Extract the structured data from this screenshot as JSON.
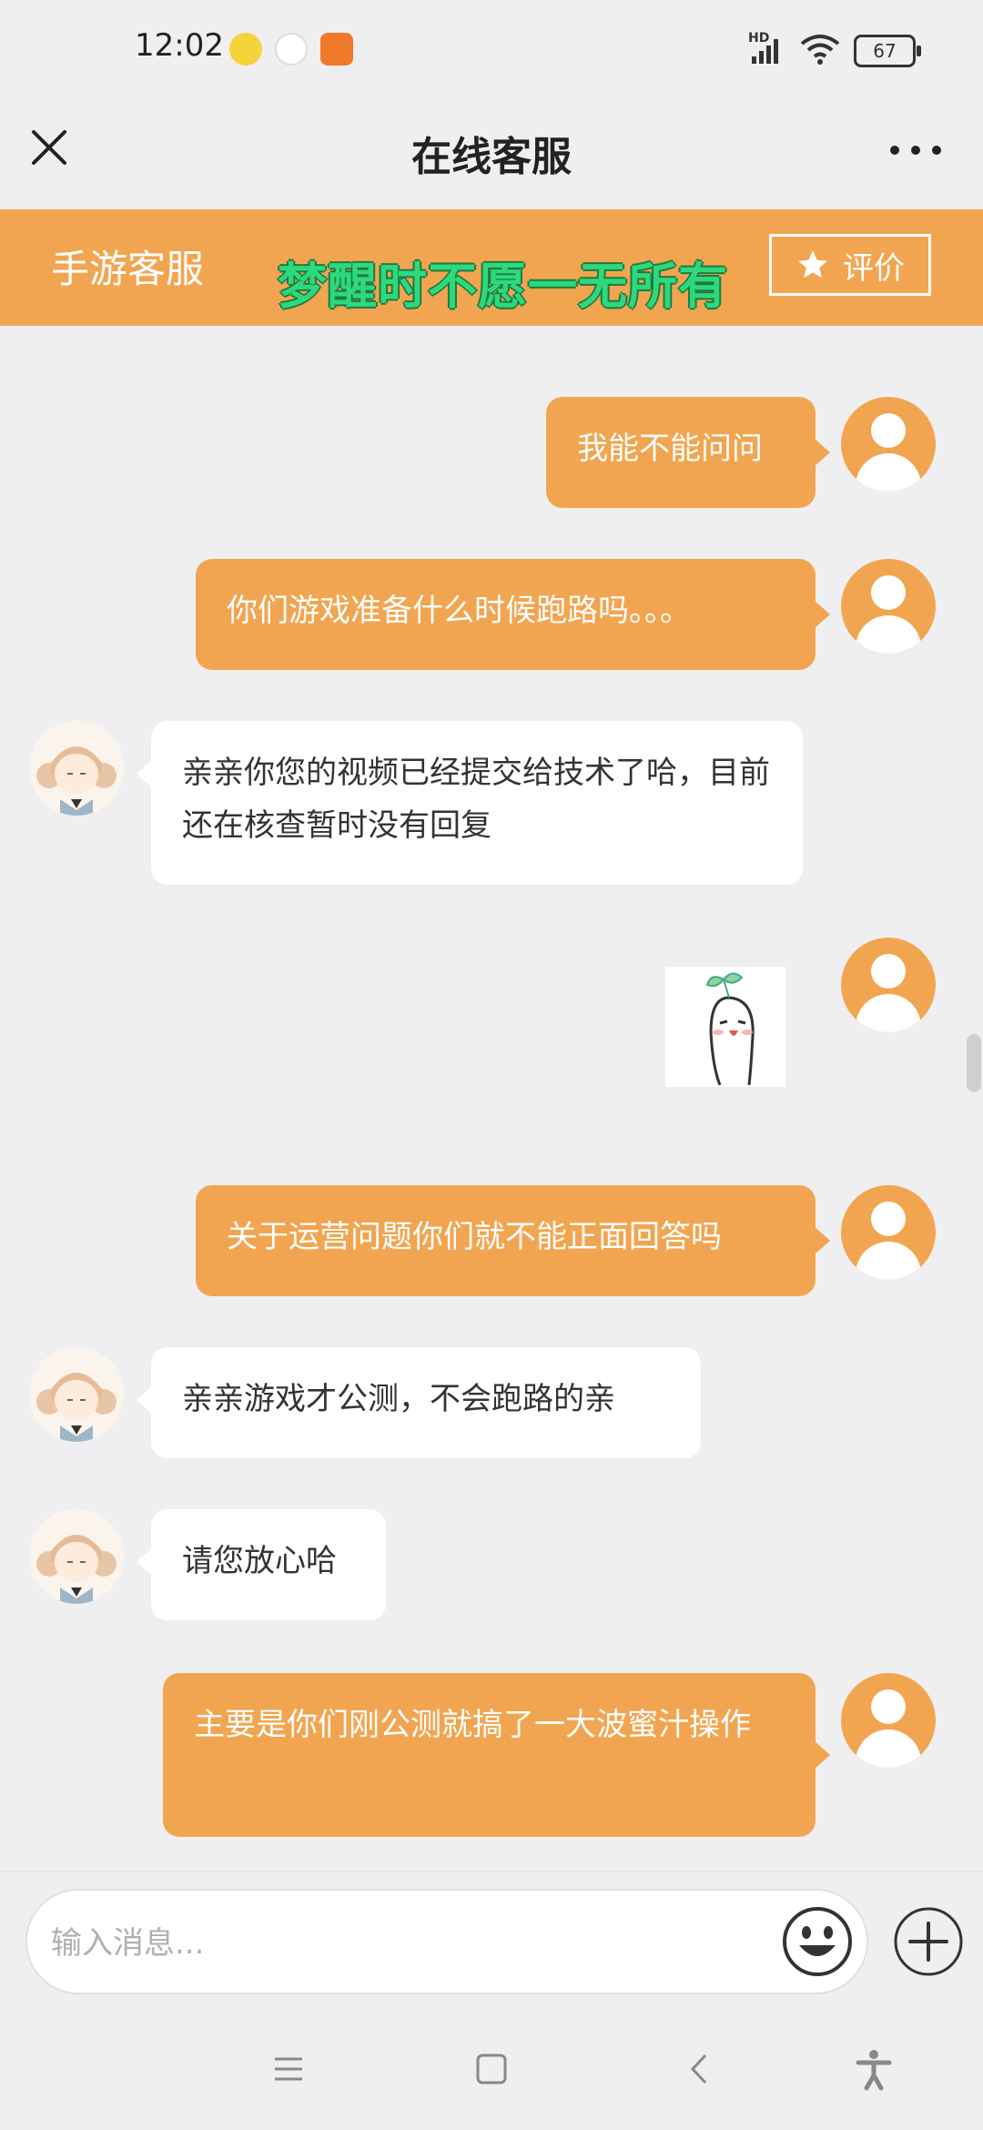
{
  "status_bar": {
    "time": "12:02",
    "battery": "67",
    "network": "HD"
  },
  "header": {
    "title": "在线客服",
    "close_icon": "close-icon",
    "more_icon": "more-icon"
  },
  "banner": {
    "label": "手游客服",
    "slogan": "梦醒时不愿一无所有",
    "rate_label": "评价"
  },
  "messages": [
    {
      "sender": "user",
      "text": "我能不能问问"
    },
    {
      "sender": "user",
      "text": "你们游戏准备什么时候跑路吗。。。"
    },
    {
      "sender": "agent",
      "text": "亲亲你您的视频已经提交给技术了哈，目前还在核查暂时没有回复"
    },
    {
      "sender": "user",
      "type": "sticker",
      "icon": "sticker-image"
    },
    {
      "sender": "user",
      "text": "关于运营问题你们就不能正面回答吗"
    },
    {
      "sender": "agent",
      "text": "亲亲游戏才公测，不会跑路的亲"
    },
    {
      "sender": "agent",
      "text": "请您放心哈"
    },
    {
      "sender": "user",
      "text": "主要是你们刚公测就搞了一大波蜜汁操作"
    }
  ],
  "input": {
    "placeholder": "输入消息..."
  },
  "colors": {
    "accent": "#f2a550",
    "slogan_green": "#2ed87d",
    "background": "#efeff1"
  }
}
